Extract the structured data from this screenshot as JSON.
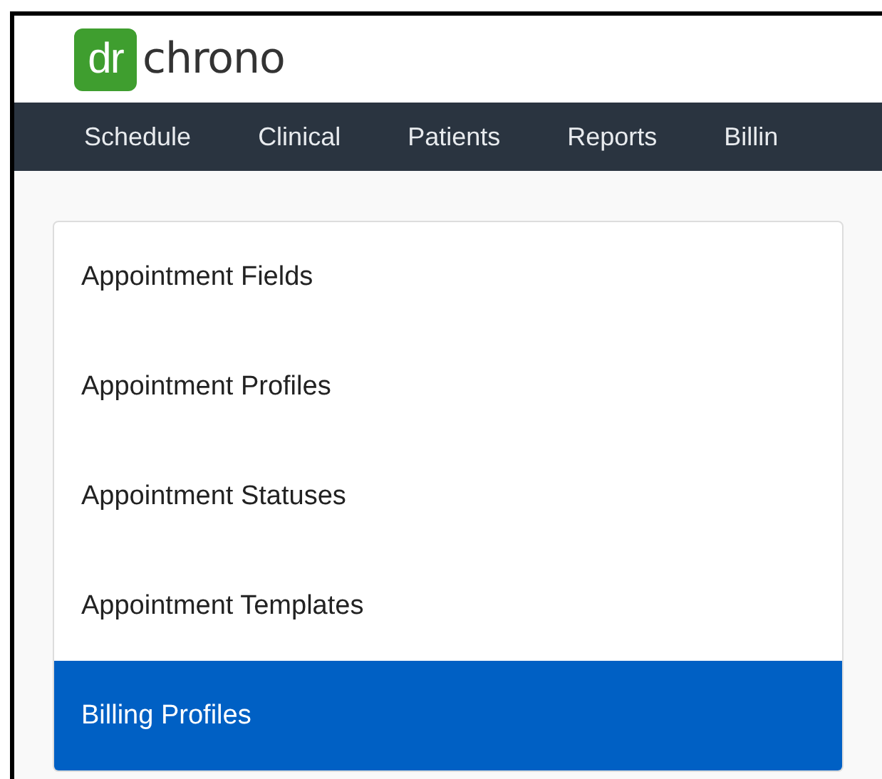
{
  "logo": {
    "mark": "dr",
    "wordmark": "chrono"
  },
  "nav": [
    {
      "label": "Schedule"
    },
    {
      "label": "Clinical"
    },
    {
      "label": "Patients"
    },
    {
      "label": "Reports"
    },
    {
      "label": "Billin"
    }
  ],
  "settings_menu": [
    {
      "label": "Appointment Fields",
      "selected": false
    },
    {
      "label": "Appointment Profiles",
      "selected": false
    },
    {
      "label": "Appointment Statuses",
      "selected": false
    },
    {
      "label": "Appointment Templates",
      "selected": false
    },
    {
      "label": "Billing Profiles",
      "selected": true
    }
  ]
}
